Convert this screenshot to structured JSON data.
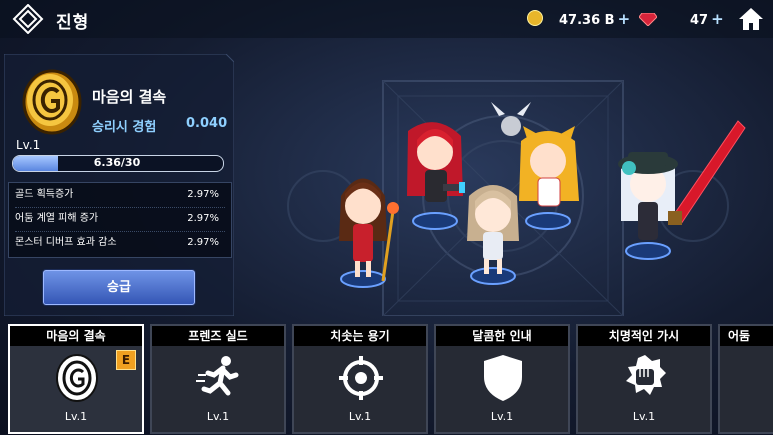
{
  "header": {
    "title": "진형",
    "gold": "47.36 B",
    "gems": "47",
    "plus_symbol": "+"
  },
  "selected_skill": {
    "name": "마음의 결속",
    "exp_label": "승리시 경험",
    "exp_value": "0.040",
    "level": "Lv.1",
    "progress_text": "6.36/30",
    "progress_fraction": 0.212,
    "stats": [
      {
        "label": "골드 획득증가",
        "value": "2.97%"
      },
      {
        "label": "어둠 계열 피해 증가",
        "value": "2.97%"
      },
      {
        "label": "몬스터 디버프 효과 감소",
        "value": "2.97%"
      }
    ],
    "promote_label": "승급"
  },
  "skills": [
    {
      "name": "마음의 결속",
      "level": "Lv.1",
      "icon": "coin-g-icon",
      "badge": "E",
      "selected": true
    },
    {
      "name": "프렌즈 실드",
      "level": "Lv.1",
      "icon": "running-man-icon"
    },
    {
      "name": "치솟는 용기",
      "level": "Lv.1",
      "icon": "crosshair-icon"
    },
    {
      "name": "달콤한 인내",
      "level": "Lv.1",
      "icon": "shield-icon"
    },
    {
      "name": "치명적인 가시",
      "level": "Lv.1",
      "icon": "fist-icon"
    },
    {
      "name": "어둠",
      "level": "",
      "icon": "unknown-icon"
    }
  ],
  "colors": {
    "accent_blue": "#8fd0ff",
    "gold": "#e8b62a",
    "gem": "#d8243a",
    "badge": "#f0a020"
  }
}
